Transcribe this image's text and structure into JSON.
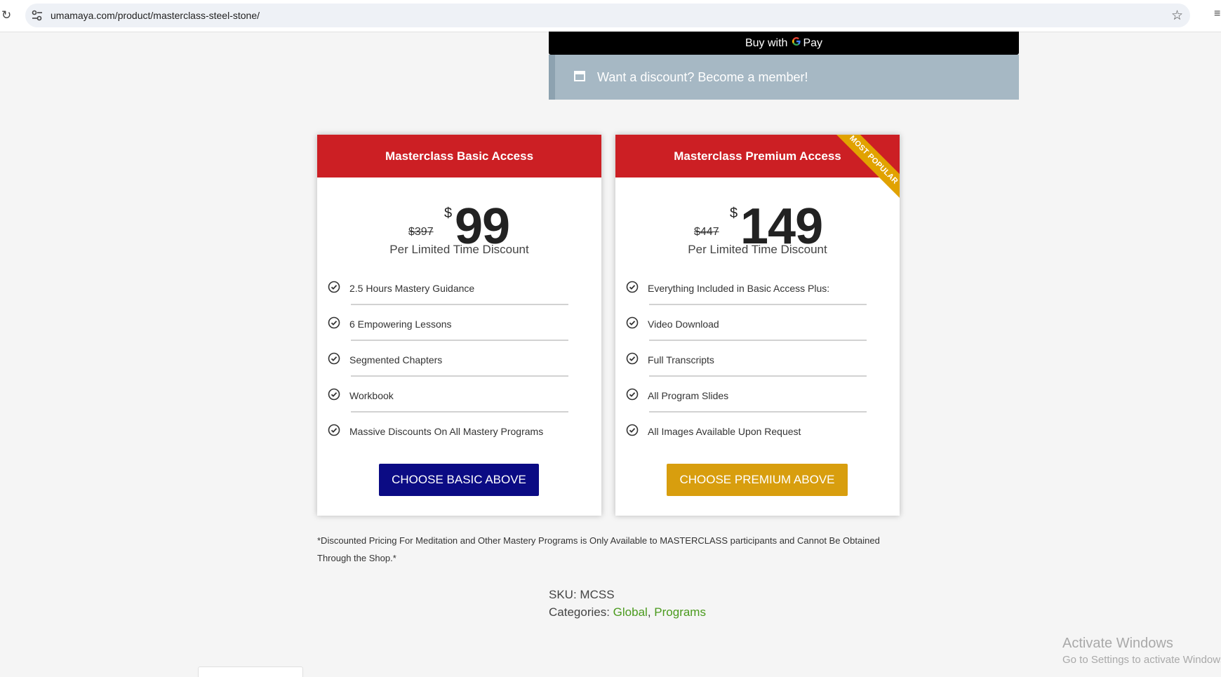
{
  "browser": {
    "url": "umamaya.com/product/masterclass-steel-stone/",
    "icons": {
      "reload": "reload-icon",
      "site_info": "tune-icon",
      "bookmark": "star-icon",
      "menu": "menu-icon"
    }
  },
  "checkout": {
    "gpay_prefix": "Buy with",
    "gpay_g": "G",
    "gpay_suffix": "Pay",
    "member_notice": "Want a discount? Become a member!"
  },
  "plans": [
    {
      "title": "Masterclass Basic Access",
      "old_price": "$397",
      "currency": "$",
      "price": "99",
      "price_note": "Per Limited Time Discount",
      "features": [
        "2.5 Hours Mastery Guidance",
        "6 Empowering Lessons",
        "Segmented Chapters",
        "Workbook",
        "Massive Discounts On All Mastery Programs"
      ],
      "button": "CHOOSE BASIC ABOVE",
      "button_color": "#0b0b84"
    },
    {
      "title": "Masterclass Premium Access",
      "ribbon": "MOST POPULAR",
      "old_price": "$447",
      "currency": "$",
      "price": "149",
      "price_note": "Per Limited Time Discount",
      "features": [
        "Everything Included in Basic Access Plus:",
        "Video Download",
        "Full Transcripts",
        "All Program Slides",
        "All Images Available Upon Request"
      ],
      "button": "CHOOSE PREMIUM ABOVE",
      "button_color": "#d89e0e"
    }
  ],
  "header_color": "#cc1f24",
  "disclaimer": "*Discounted Pricing For Meditation and Other Mastery Programs is Only Available to MASTERCLASS participants and Cannot Be Obtained Through the Shop.*",
  "meta": {
    "sku_label": "SKU:",
    "sku": "MCSS",
    "categories_label": "Categories:",
    "categories": [
      "Global",
      "Programs"
    ],
    "separator": ","
  },
  "os_watermark": {
    "line1": "Activate Windows",
    "line2": "Go to Settings to activate Windows."
  }
}
